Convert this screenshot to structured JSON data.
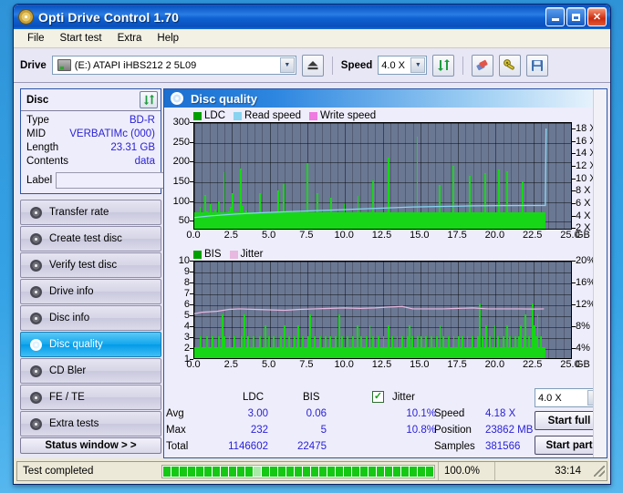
{
  "window": {
    "title": "Opti Drive Control 1.70",
    "icon": "disc-icon",
    "minimize": "_",
    "maximize": "□",
    "close": "✕"
  },
  "menu": {
    "items": [
      "File",
      "Start test",
      "Extra",
      "Help"
    ]
  },
  "toolbar": {
    "drive_label": "Drive",
    "drive_value": "(E:)   ATAPI iHBS212  2 5L09",
    "eject_icon": "eject-icon",
    "speed_label": "Speed",
    "speed_value": "4.0 X",
    "refresh_icon": "refresh-icon",
    "eraser_icon": "eraser-icon",
    "tools_icon": "tools-icon",
    "save_icon": "save-icon"
  },
  "sidebar": {
    "disc_panel": {
      "title": "Disc",
      "refresh_icon": "refresh-icon",
      "rows": [
        {
          "key": "Type",
          "value": "BD-R"
        },
        {
          "key": "MID",
          "value": "VERBATIMc (000)"
        },
        {
          "key": "Length",
          "value": "23.31 GB"
        },
        {
          "key": "Contents",
          "value": "data"
        }
      ],
      "label_key": "Label",
      "label_value": "",
      "label_placeholder": "",
      "disc_icon": "disc-icon"
    },
    "nav_items": [
      {
        "label": "Transfer rate",
        "active": false
      },
      {
        "label": "Create test disc",
        "active": false
      },
      {
        "label": "Verify test disc",
        "active": false
      },
      {
        "label": "Drive info",
        "active": false
      },
      {
        "label": "Disc info",
        "active": false
      },
      {
        "label": "Disc quality",
        "active": true
      },
      {
        "label": "CD Bler",
        "active": false
      },
      {
        "label": "FE / TE",
        "active": false
      },
      {
        "label": "Extra tests",
        "active": false
      }
    ],
    "status_button": "Status window > >"
  },
  "main": {
    "header": {
      "title": "Disc quality",
      "icon": "disc-icon"
    }
  },
  "chart_data": [
    {
      "type": "bar",
      "id": "ldc-chart",
      "title": "",
      "xlabel": "GB",
      "ylabel": "LDC",
      "legend": [
        {
          "label": "LDC",
          "color": "#00a000"
        },
        {
          "label": "Read speed",
          "color": "#87d3f0"
        },
        {
          "label": "Write speed",
          "color": "#ef7ae0"
        }
      ],
      "xlim": [
        0,
        25
      ],
      "xticks": [
        "0.0",
        "2.5",
        "5.0",
        "7.5",
        "10.0",
        "12.5",
        "15.0",
        "17.5",
        "20.0",
        "22.5",
        "25.0"
      ],
      "xunit": "GB",
      "ylim": [
        0,
        300
      ],
      "yticks": [
        50,
        100,
        150,
        200,
        250,
        300
      ],
      "y2lim": [
        0,
        19
      ],
      "y2ticks": [
        "2 X",
        "4 X",
        "6 X",
        "8 X",
        "10 X",
        "12 X",
        "14 X",
        "16 X",
        "18 X"
      ],
      "grid": true,
      "data_end_x": 23.3,
      "series": [
        {
          "name": "LDC",
          "color": "#17d617",
          "values": [
            32,
            26,
            40,
            55,
            24,
            30,
            86,
            45,
            28,
            62,
            36,
            22,
            48,
            30,
            70,
            26,
            38,
            142,
            30,
            24,
            44,
            55,
            90,
            28,
            34,
            20,
            26,
            152,
            58,
            30,
            46,
            22,
            34,
            28,
            30,
            38,
            26,
            24,
            90,
            32,
            26,
            22,
            30,
            26,
            34,
            20,
            28,
            30,
            24,
            98,
            36,
            26,
            112,
            28,
            34,
            22,
            30,
            26,
            38,
            24,
            30,
            34,
            22,
            28,
            30,
            26,
            166,
            34,
            24,
            30,
            28,
            22,
            90,
            36,
            26,
            30,
            24,
            28,
            32,
            22,
            78,
            26,
            30,
            24,
            34,
            28,
            22,
            26,
            62,
            30,
            24,
            28,
            34,
            22,
            30,
            26,
            82,
            24,
            30,
            28,
            22,
            34,
            26,
            30,
            24,
            122,
            28,
            22,
            30,
            26,
            34,
            24,
            30,
            28,
            180,
            26,
            30,
            24,
            22,
            34,
            28,
            30,
            26,
            24,
            30,
            22,
            34,
            28,
            26,
            30,
            24,
            232,
            30,
            28,
            22,
            34,
            26,
            30,
            24,
            28,
            30,
            22,
            34,
            26,
            110,
            30,
            24,
            28,
            22,
            34,
            26,
            30,
            160,
            28,
            22,
            30,
            26,
            34,
            24,
            30,
            28,
            22,
            135,
            26,
            30,
            24,
            34,
            28,
            22,
            30,
            26,
            140,
            34,
            30,
            24,
            28,
            22,
            30,
            26,
            150,
            34,
            28,
            22,
            30,
            145,
            26,
            34,
            30,
            28,
            22,
            30,
            26,
            34,
            120,
            28,
            30,
            22,
            26,
            34,
            30,
            28,
            22,
            30,
            26,
            34,
            28,
            30
          ]
        },
        {
          "name": "Read speed",
          "color": "#87d3f0",
          "points": [
            [
              0.0,
              2.0
            ],
            [
              1.0,
              2.3
            ],
            [
              2.5,
              2.6
            ],
            [
              4.5,
              2.9
            ],
            [
              6.5,
              3.1
            ],
            [
              8.5,
              3.3
            ],
            [
              10.5,
              3.5
            ],
            [
              12.5,
              3.7
            ],
            [
              14.5,
              3.9
            ],
            [
              16.5,
              4.0
            ],
            [
              18.5,
              4.1
            ],
            [
              20.5,
              4.15
            ],
            [
              22.5,
              4.18
            ],
            [
              23.3,
              4.18
            ],
            [
              23.35,
              18.0
            ]
          ]
        }
      ],
      "stats": {
        "columns": [
          "LDC",
          "BIS"
        ],
        "rows": [
          {
            "label": "Avg",
            "ldc": "3.00",
            "bis": "0.06"
          },
          {
            "label": "Max",
            "ldc": "232",
            "bis": "5"
          },
          {
            "label": "Total",
            "ldc": "1146602",
            "bis": "22475"
          }
        ]
      }
    },
    {
      "type": "bar",
      "id": "bis-chart",
      "title": "",
      "xlabel": "GB",
      "ylabel": "BIS",
      "legend": [
        {
          "label": "BIS",
          "color": "#00a000"
        },
        {
          "label": "Jitter",
          "color": "#e8b8e0"
        }
      ],
      "xlim": [
        0,
        25
      ],
      "xticks": [
        "0.0",
        "2.5",
        "5.0",
        "7.5",
        "10.0",
        "12.5",
        "15.0",
        "17.5",
        "20.0",
        "22.5",
        "25.0"
      ],
      "xunit": "GB",
      "ylim": [
        0,
        10
      ],
      "yticks": [
        1,
        2,
        3,
        4,
        5,
        6,
        7,
        8,
        9,
        10
      ],
      "y2lim": [
        0,
        20
      ],
      "y2ticks": [
        "4%",
        "8%",
        "12%",
        "16%",
        "20%"
      ],
      "grid": true,
      "data_end_x": 23.3,
      "series": [
        {
          "name": "BIS",
          "color": "#17d617",
          "values": [
            1,
            1,
            1,
            2,
            1,
            1,
            1,
            2,
            1,
            1,
            2,
            1,
            1,
            1,
            2,
            1,
            4,
            2,
            1,
            1,
            2,
            1,
            1,
            2,
            1,
            1,
            1,
            2,
            1,
            4,
            1,
            2,
            1,
            1,
            2,
            1,
            1,
            1,
            2,
            1,
            1,
            3,
            1,
            2,
            1,
            1,
            2,
            1,
            1,
            1,
            2,
            1,
            3,
            1,
            1,
            2,
            1,
            1,
            2,
            1,
            3,
            1,
            1,
            2,
            1,
            1,
            2,
            4,
            1,
            1,
            2,
            1,
            1,
            2,
            1,
            1,
            2,
            1,
            1,
            2,
            1,
            1,
            2,
            1,
            4,
            1,
            2,
            1,
            1,
            2,
            1,
            1,
            2,
            1,
            1,
            3,
            1,
            2,
            1,
            1,
            2,
            1,
            3,
            1,
            2,
            1,
            1,
            2,
            1,
            1,
            2,
            1,
            1,
            3,
            1,
            2,
            1,
            1,
            2,
            1,
            1,
            2,
            1,
            1,
            2,
            3,
            1,
            2,
            1,
            1,
            2,
            1,
            2,
            1,
            1,
            2,
            1,
            1,
            2,
            1,
            1,
            2,
            1,
            3,
            1,
            2,
            1,
            1,
            2,
            1,
            1,
            2,
            1,
            1,
            2,
            1,
            2,
            1,
            1,
            2,
            1,
            1,
            2,
            1,
            1,
            2,
            5,
            1,
            2,
            1,
            3,
            1,
            2,
            1,
            1,
            3,
            1,
            2,
            1,
            1,
            2,
            1,
            3,
            1,
            2,
            1,
            1,
            2,
            1,
            2,
            3,
            1,
            2,
            4,
            1,
            2,
            1,
            5,
            3,
            2,
            4,
            1,
            2,
            1,
            1
          ]
        },
        {
          "name": "Jitter",
          "color": "#e8b8e0",
          "points": [
            [
              0.0,
              4.6
            ],
            [
              0.5,
              4.75
            ],
            [
              1.0,
              4.8
            ],
            [
              1.5,
              4.85
            ],
            [
              2.3,
              5.05
            ],
            [
              3.0,
              5.1
            ],
            [
              4.0,
              5.05
            ],
            [
              5.0,
              5.0
            ],
            [
              6.0,
              4.95
            ],
            [
              7.0,
              5.05
            ],
            [
              8.0,
              5.1
            ],
            [
              9.0,
              5.15
            ],
            [
              10.0,
              5.2
            ],
            [
              11.0,
              5.15
            ],
            [
              12.0,
              5.2
            ],
            [
              13.0,
              5.3
            ],
            [
              13.8,
              5.35
            ],
            [
              14.5,
              5.1
            ],
            [
              15.5,
              5.1
            ],
            [
              16.5,
              5.1
            ],
            [
              17.5,
              5.15
            ],
            [
              18.5,
              5.2
            ],
            [
              19.5,
              5.1
            ],
            [
              20.5,
              5.1
            ],
            [
              21.5,
              5.1
            ],
            [
              22.5,
              5.08
            ],
            [
              23.2,
              5.1
            ]
          ]
        }
      ]
    }
  ],
  "stats_panel": {
    "col_ldc": "LDC",
    "col_bis": "BIS",
    "row_avg": "Avg",
    "row_max": "Max",
    "row_total": "Total",
    "avg_ldc": "3.00",
    "avg_bis": "0.06",
    "max_ldc": "232",
    "max_bis": "5",
    "total_ldc": "1146602",
    "total_bis": "22475",
    "jitter_checked": true,
    "jitter_label": "Jitter",
    "jitter_avg": "10.1%",
    "jitter_max": "10.8%",
    "speed_label": "Speed",
    "speed_value": "4.18 X",
    "position_label": "Position",
    "position_value": "23862 MB",
    "samples_label": "Samples",
    "samples_value": "381566",
    "speed_select": "4.0 X",
    "start_full": "Start full",
    "start_part": "Start part"
  },
  "statusbar": {
    "message": "Test completed",
    "progress_percent": "100.0%",
    "progress_value": 100,
    "elapsed": "33:14"
  },
  "colors": {
    "accent": "#0b55c3",
    "plot_bg": "#6b7894",
    "green": "#17d617",
    "read_speed": "#87d3f0",
    "jitter": "#e8b8e0",
    "value_text": "#2a22d6"
  }
}
